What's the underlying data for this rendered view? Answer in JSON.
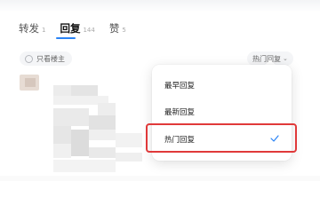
{
  "tabs": [
    {
      "label": "转发",
      "count": "1"
    },
    {
      "label": "回复",
      "count": "144"
    },
    {
      "label": "赞",
      "count": "5"
    }
  ],
  "filter": {
    "only_author_label": "只看楼主"
  },
  "sort": {
    "current_label": "热门回复"
  },
  "menu": {
    "items": [
      {
        "label": "最早回复"
      },
      {
        "label": "最新回复"
      },
      {
        "label": "热门回复"
      }
    ],
    "selected": "热门回复"
  },
  "colors": {
    "accent": "#2a83f5",
    "highlight": "#e0393a"
  }
}
